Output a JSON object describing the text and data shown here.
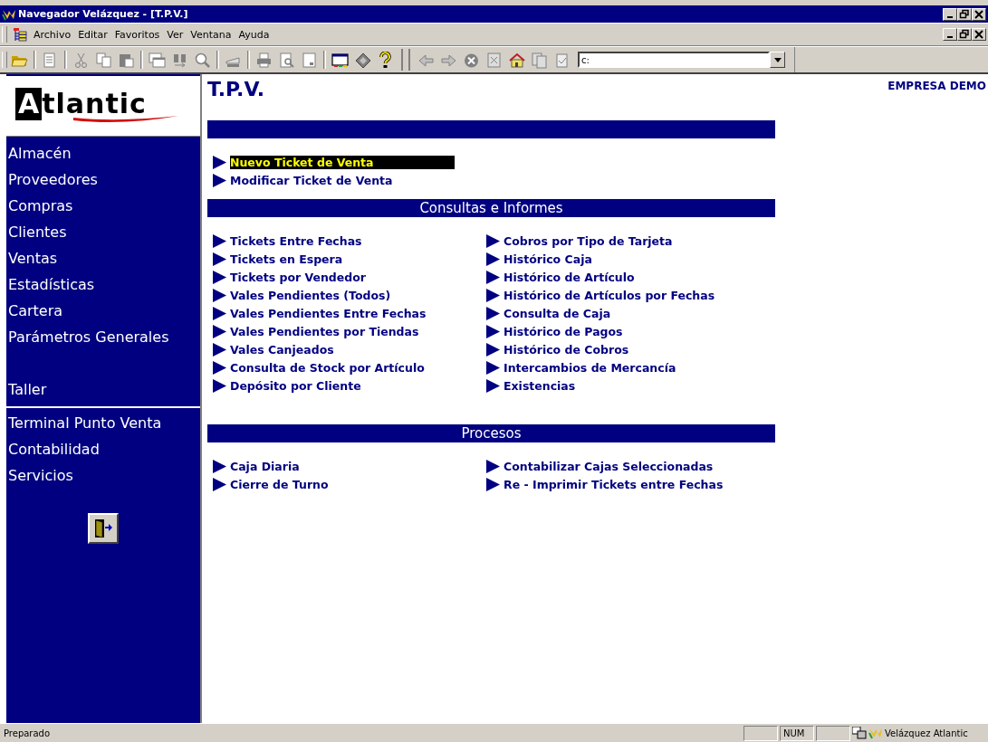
{
  "window": {
    "title": "Navegador Velázquez - [T.P.V.]"
  },
  "menu": [
    "Archivo",
    "Editar",
    "Favoritos",
    "Ver",
    "Ventana",
    "Ayuda"
  ],
  "address": {
    "value": "c:"
  },
  "logo": {
    "initial": "A",
    "text": "tlantic"
  },
  "sidebar": {
    "groups": [
      {
        "kind": "plain",
        "items": [
          "Almacén",
          "Proveedores",
          "Compras",
          "Clientes",
          "Ventas",
          "Estadísticas",
          "Cartera",
          "Parámetros Generales"
        ]
      },
      {
        "kind": "spaced",
        "items": [
          "Taller"
        ]
      },
      {
        "kind": "ruled",
        "items": [
          "Terminal Punto Venta",
          "Contabilidad",
          "Servicios"
        ]
      }
    ]
  },
  "page": {
    "title": "T.P.V.",
    "company": "EMPRESA DEMO"
  },
  "sections": [
    {
      "columns": [
        [
          {
            "label": "Nuevo Ticket de Venta",
            "selected": true
          },
          {
            "label": "Modificar Ticket de Venta",
            "selected": false
          }
        ]
      ]
    },
    {
      "title": "Consultas e Informes",
      "columns": [
        [
          {
            "label": "Tickets Entre Fechas",
            "selected": false
          },
          {
            "label": "Tickets en Espera",
            "selected": false
          },
          {
            "label": "Tickets por Vendedor",
            "selected": false
          },
          {
            "label": "Vales Pendientes (Todos)",
            "selected": false
          },
          {
            "label": "Vales Pendientes Entre Fechas",
            "selected": false
          },
          {
            "label": "Vales Pendientes por Tiendas",
            "selected": false
          },
          {
            "label": "Vales Canjeados",
            "selected": false
          },
          {
            "label": "Consulta de Stock por Artículo",
            "selected": false
          },
          {
            "label": "Depósito por Cliente",
            "selected": false
          }
        ],
        [
          {
            "label": "Cobros por Tipo de Tarjeta",
            "selected": false
          },
          {
            "label": "Histórico Caja",
            "selected": false
          },
          {
            "label": "Histórico de Artículo",
            "selected": false
          },
          {
            "label": "Histórico de Artículos por Fechas",
            "selected": false
          },
          {
            "label": "Consulta de Caja",
            "selected": false
          },
          {
            "label": "Histórico de Pagos",
            "selected": false
          },
          {
            "label": "Histórico de Cobros",
            "selected": false
          },
          {
            "label": "Intercambios de Mercancía",
            "selected": false
          },
          {
            "label": "Existencias",
            "selected": false
          }
        ]
      ]
    },
    {
      "title": "Procesos",
      "columns": [
        [
          {
            "label": "Caja Diaria",
            "selected": false
          },
          {
            "label": "Cierre de Turno",
            "selected": false
          }
        ],
        [
          {
            "label": "Contabilizar Cajas Seleccionadas",
            "selected": false
          },
          {
            "label": "Re - Imprimir Tickets entre Fechas",
            "selected": false
          }
        ]
      ]
    }
  ],
  "status_bar": {
    "message": "Preparado",
    "indicator": "NUM",
    "app": "Velázquez Atlantic"
  }
}
